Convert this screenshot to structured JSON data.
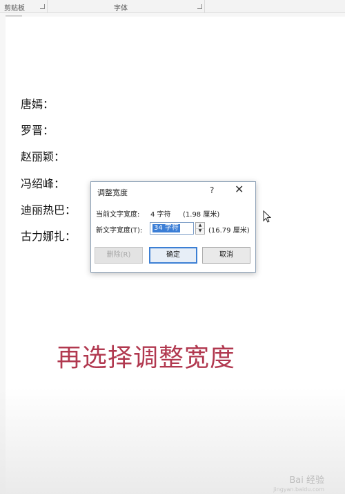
{
  "ribbon": {
    "clipboard_group": "剪贴板",
    "font_group": "字体"
  },
  "document": {
    "names": [
      "唐嫣：",
      "罗晋：",
      "赵丽颖：",
      "冯绍峰：",
      "迪丽热巴：",
      "古力娜扎："
    ],
    "caption": "再选择调整宽度"
  },
  "dialog": {
    "title": "调整宽度",
    "help": "?",
    "close": "✕",
    "current_label": "当前文字宽度:",
    "current_value": "4 字符",
    "current_cm": "(1.98 厘米)",
    "new_label": "新文字宽度(T):",
    "new_value": "34 字符",
    "new_cm": "(16.79 厘米)",
    "delete_button": "删除(R)",
    "ok_button": "确定",
    "cancel_button": "取消"
  },
  "watermark": {
    "text": "Bai 经验",
    "url": "jingyan.baidu.com"
  }
}
